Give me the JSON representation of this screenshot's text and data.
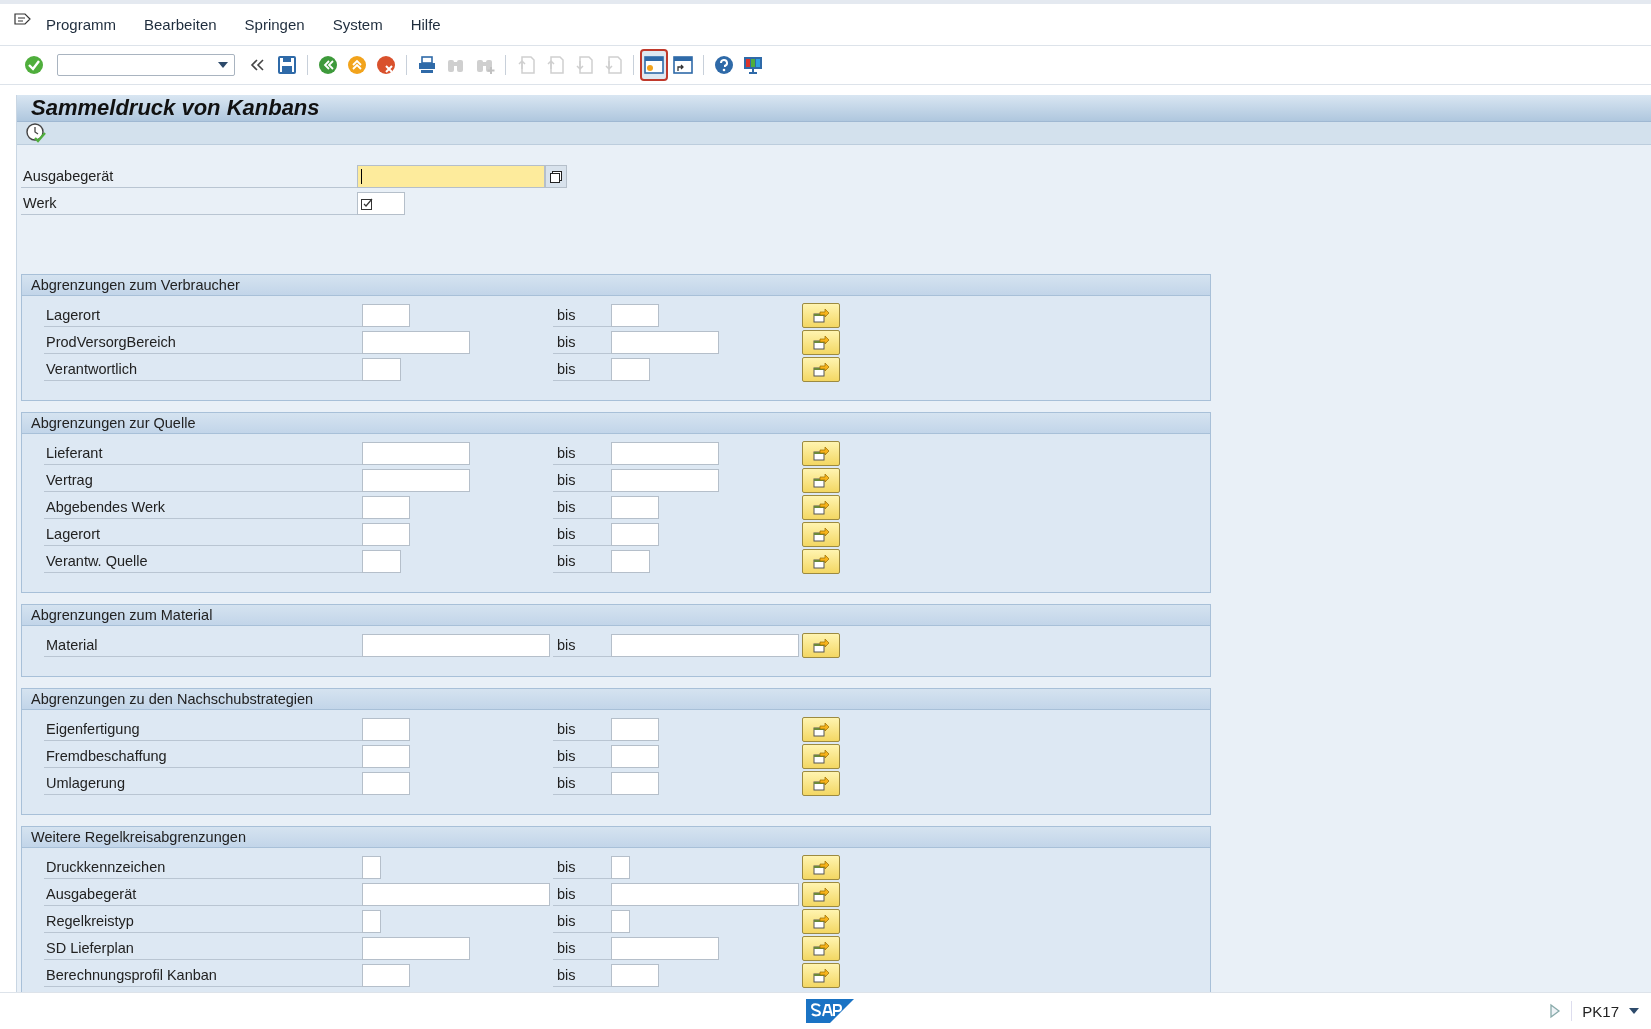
{
  "menu": [
    {
      "label": "Programm"
    },
    {
      "label": "Bearbeiten"
    },
    {
      "label": "Springen"
    },
    {
      "label": "System"
    },
    {
      "label": "Hilfe"
    }
  ],
  "toolbar_groups": [
    {
      "buttons": [
        {
          "kind": "enter",
          "disabled": false,
          "focused": false
        },
        {
          "kind": "command",
          "disabled": false,
          "focused": false
        },
        {
          "kind": "collapse",
          "disabled": false,
          "focused": false
        },
        {
          "kind": "save",
          "disabled": false,
          "focused": false
        }
      ]
    },
    {
      "buttons": [
        {
          "kind": "back",
          "disabled": false,
          "focused": false
        },
        {
          "kind": "exit",
          "disabled": false,
          "focused": false
        },
        {
          "kind": "cancel",
          "disabled": false,
          "focused": false
        }
      ]
    },
    {
      "buttons": [
        {
          "kind": "print",
          "disabled": false,
          "focused": false
        },
        {
          "kind": "find",
          "disabled": true,
          "focused": false
        },
        {
          "kind": "findnext",
          "disabled": true,
          "focused": false
        }
      ]
    },
    {
      "buttons": [
        {
          "kind": "first",
          "disabled": true,
          "focused": false
        },
        {
          "kind": "prev",
          "disabled": true,
          "focused": false
        },
        {
          "kind": "next",
          "disabled": true,
          "focused": false
        },
        {
          "kind": "last",
          "disabled": true,
          "focused": false
        }
      ]
    },
    {
      "buttons": [
        {
          "kind": "newsession",
          "disabled": false,
          "focused": true
        },
        {
          "kind": "shortcut",
          "disabled": false,
          "focused": false
        }
      ]
    },
    {
      "buttons": [
        {
          "kind": "help",
          "disabled": false,
          "focused": false
        },
        {
          "kind": "layout",
          "disabled": false,
          "focused": false
        }
      ]
    }
  ],
  "title": "Sammeldruck von Kanbans",
  "top_fields": [
    {
      "label": "Ausgabegerät",
      "kind": "xl",
      "focused": true,
      "required": false
    },
    {
      "label": "Werk",
      "kind": "m",
      "focused": false,
      "required": true
    }
  ],
  "sections": [
    {
      "title": "Abgrenzungen zum Verbraucher",
      "rows": [
        {
          "label": "Lagerort",
          "kind": "m",
          "to_label": "bis"
        },
        {
          "label": "ProdVersorgBereich",
          "kind": "l",
          "to_label": "bis"
        },
        {
          "label": "Verantwortlich",
          "kind": "s",
          "to_label": "bis"
        }
      ]
    },
    {
      "title": "Abgrenzungen zur Quelle",
      "rows": [
        {
          "label": "Lieferant",
          "kind": "l",
          "to_label": "bis"
        },
        {
          "label": "Vertrag",
          "kind": "l",
          "to_label": "bis"
        },
        {
          "label": "Abgebendes Werk",
          "kind": "m",
          "to_label": "bis"
        },
        {
          "label": "Lagerort",
          "kind": "m",
          "to_label": "bis"
        },
        {
          "label": "Verantw. Quelle",
          "kind": "s",
          "to_label": "bis"
        }
      ]
    },
    {
      "title": "Abgrenzungen zum Material",
      "rows": [
        {
          "label": "Material",
          "kind": "xl",
          "to_label": "bis"
        }
      ]
    },
    {
      "title": "Abgrenzungen zu den Nachschubstrategien",
      "rows": [
        {
          "label": "Eigenfertigung",
          "kind": "m",
          "to_label": "bis"
        },
        {
          "label": "Fremdbeschaffung",
          "kind": "m",
          "to_label": "bis"
        },
        {
          "label": "Umlagerung",
          "kind": "m",
          "to_label": "bis"
        }
      ]
    },
    {
      "title": "Weitere Regelkreisabgrenzungen",
      "rows": [
        {
          "label": "Druckkennzeichen",
          "kind": "xs",
          "to_label": "bis"
        },
        {
          "label": "Ausgabegerät",
          "kind": "xl",
          "to_label": "bis"
        },
        {
          "label": "Regelkreistyp",
          "kind": "xs",
          "to_label": "bis"
        },
        {
          "label": "SD Lieferplan",
          "kind": "l",
          "to_label": "bis"
        },
        {
          "label": "Berechnungsprofil Kanban",
          "kind": "m",
          "to_label": "bis"
        }
      ]
    }
  ],
  "status_bar": {
    "transaction": "PK17"
  }
}
